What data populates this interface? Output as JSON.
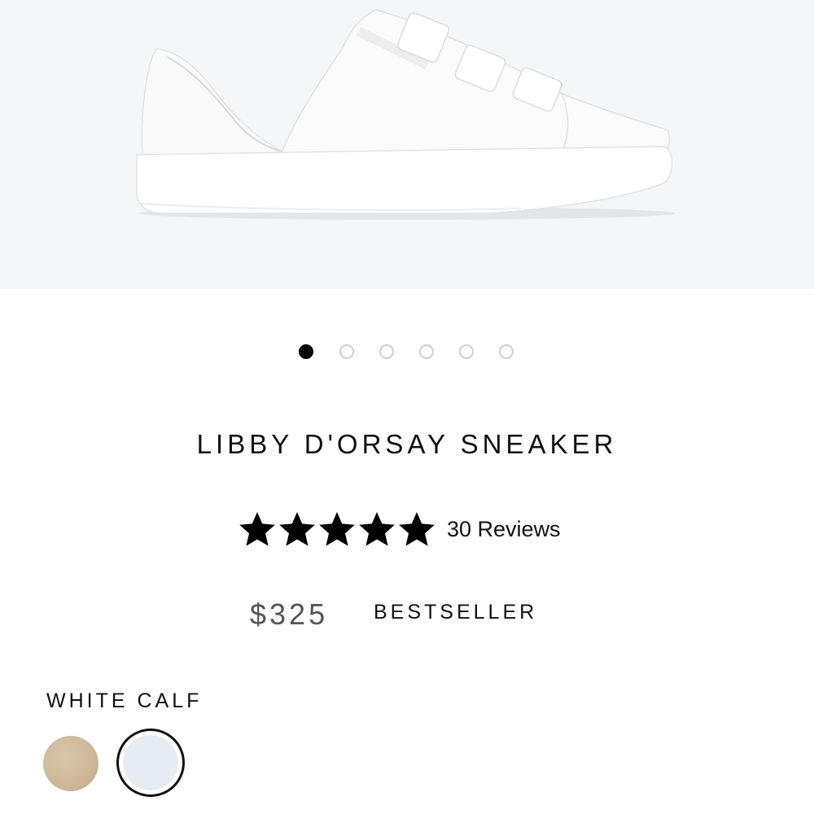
{
  "product": {
    "name": "LIBBY D'ORSAY SNEAKER",
    "rating": 5,
    "rating_max": 5,
    "reviews_label": "30 Reviews",
    "price": "$325",
    "badge": "BESTSELLER",
    "selected_color": "WHITE CALF"
  },
  "carousel": {
    "total": 6,
    "active_index": 0
  },
  "swatches": [
    {
      "name": "tan-swatch",
      "color": "#cdb999",
      "selected": false
    },
    {
      "name": "white-calf-swatch",
      "color": "#e7ebf4",
      "selected": true
    }
  ],
  "colors": {
    "hero_bg": "#f4f6f7",
    "star": "#000000",
    "dot_active": "#000000",
    "dot_inactive": "#cfcfcf"
  },
  "icons": [
    "star-icon",
    "sneaker-image"
  ]
}
